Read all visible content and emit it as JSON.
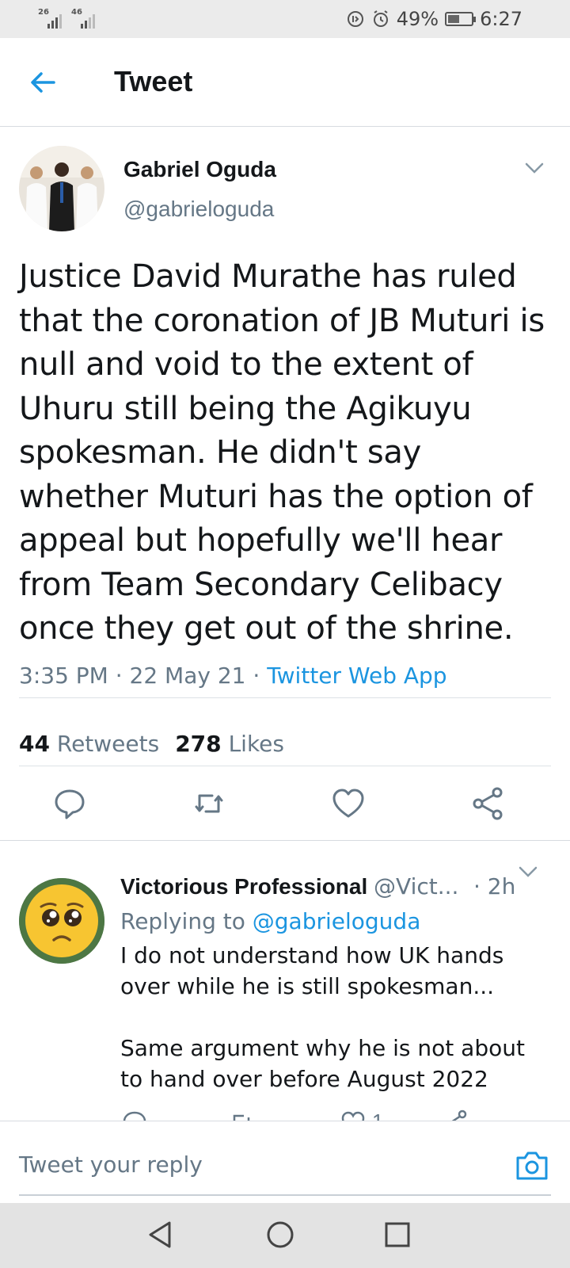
{
  "status_bar": {
    "sim1_label": "26",
    "sim2_label": "46",
    "battery_percent": "49%",
    "battery_level": 0.49,
    "time": "6:27"
  },
  "header": {
    "title": "Tweet",
    "back_icon": "back-arrow-icon"
  },
  "tweet": {
    "author_name": "Gabriel Oguda",
    "author_handle": "@gabrieloguda",
    "text": "Justice David Murathe has ruled that the coronation of JB Muturi is null and void to the extent of Uhuru still being the Agikuyu spokesman. He didn't say whether Muturi has the option of appeal but hopefully we'll hear from Team Secondary Celibacy once they get out of the shrine.",
    "time": "3:35 PM",
    "date": "22 May 21",
    "separator": " · ",
    "source": "Twitter Web App",
    "retweets_count": "44",
    "retweets_label": "Retweets",
    "likes_count": "278",
    "likes_label": "Likes",
    "actions": [
      "reply-icon",
      "retweet-icon",
      "like-icon",
      "share-icon"
    ]
  },
  "reply": {
    "author_name": "Victorious Professional",
    "author_handle": "@Vict...",
    "time": "· 2h",
    "replying_prefix": "Replying to",
    "replying_to": "@gabrieloguda",
    "text_p1": "I do not understand how UK hands over while he is still spokesman...",
    "text_p2": "Same argument why he is not about to hand over before August 2022",
    "like_count": "1"
  },
  "composer": {
    "placeholder": "Tweet your reply",
    "camera_icon": "camera-icon"
  },
  "navbar": {
    "icons": [
      "nav-back-icon",
      "nav-home-icon",
      "nav-recents-icon"
    ]
  },
  "colors": {
    "accent": "#1b95e0",
    "text": "#14171a",
    "muted": "#657786"
  }
}
